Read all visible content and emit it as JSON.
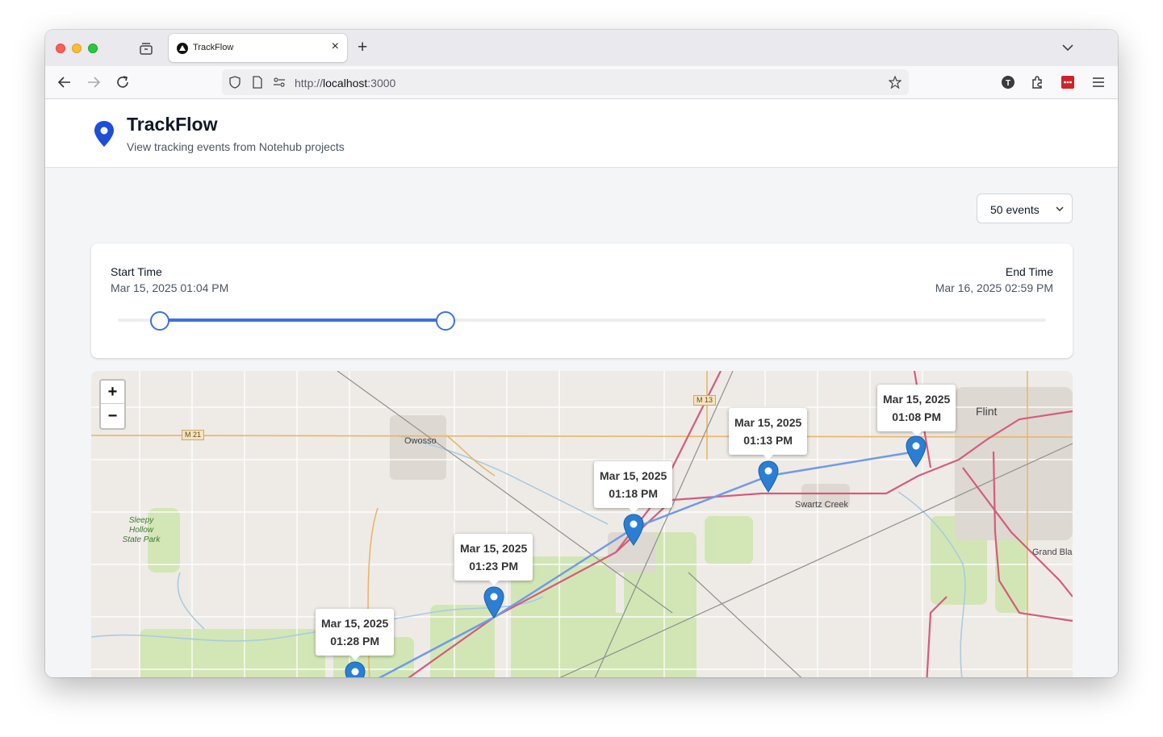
{
  "browser": {
    "tab_title": "TrackFlow",
    "url_scheme": "http://",
    "url_host": "localhost",
    "url_port": ":3000"
  },
  "app": {
    "title": "TrackFlow",
    "subtitle": "View tracking events from Notehub projects"
  },
  "events_select": {
    "value": "50 events"
  },
  "time_range": {
    "start_label": "Start Time",
    "start_value": "Mar 15, 2025 01:04 PM",
    "end_label": "End Time",
    "end_value": "Mar 16, 2025 02:59 PM",
    "slider_low_fraction": 0.045,
    "slider_high_fraction": 0.353
  },
  "map": {
    "zoom_in": "+",
    "zoom_out": "−",
    "markers": [
      {
        "date": "Mar 15, 2025",
        "time": "01:08 PM"
      },
      {
        "date": "Mar 15, 2025",
        "time": "01:13 PM"
      },
      {
        "date": "Mar 15, 2025",
        "time": "01:18 PM"
      },
      {
        "date": "Mar 15, 2025",
        "time": "01:23 PM"
      },
      {
        "date": "Mar 15, 2025",
        "time": "01:28 PM"
      }
    ],
    "places": {
      "owosso": "Owosso",
      "swartz_creek": "Swartz Creek",
      "flint": "Flint",
      "grand_blanc": "Grand Bla",
      "sleepy_hollow": "Sleepy Hollow State Park"
    },
    "road_shields": {
      "m13": "M 13",
      "m21": "M 21"
    },
    "route_color": "#6f9be8",
    "marker_color": "#2a7fd4"
  }
}
